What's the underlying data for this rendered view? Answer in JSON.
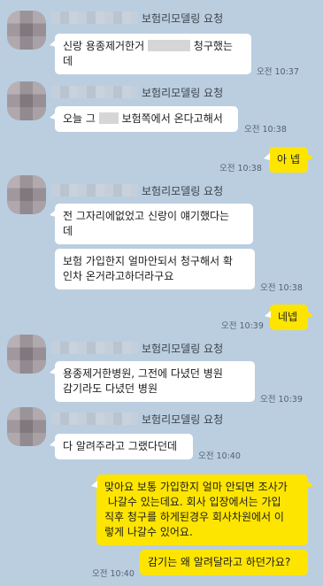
{
  "sender": {
    "display_name": "보험리모델링 요청"
  },
  "messages": [
    {
      "id": "m1",
      "pre": "신랑 용종제거한거 ",
      "post": " 청구했는\n데",
      "time": "오전 10:37"
    },
    {
      "id": "m2",
      "pre": "오늘 그 ",
      "post": " 보험쪽에서 온다고해서",
      "time": "오전 10:38"
    },
    {
      "id": "m3",
      "text": "아 넵",
      "time": "오전 10:38"
    },
    {
      "id": "m4",
      "text": "전 그자리에없었고 신랑이 얘기했다는\n데"
    },
    {
      "id": "m5",
      "text": "보험 가입한지 얼마안되서 청구해서 확\n인차 온거라고하더라구요",
      "time": "오전 10:38"
    },
    {
      "id": "m6",
      "text": "네넵",
      "time": "오전 10:39"
    },
    {
      "id": "m7",
      "text": "용종제거한병원, 그전에 다녔던 병원\n감기라도 다녔던 병원",
      "time": "오전 10:39"
    },
    {
      "id": "m8",
      "text": "다 알려주라고 그랬다던데",
      "time": "오전 10:40"
    },
    {
      "id": "m9",
      "text": "맞아요 보통 가입한지 얼마 안되면 조사가\n 나갈수 있는데요. 회사 입장에서는 가입\n직후 청구를 하게된경우 회사차원에서 이\n렇게 나갈수 있어요."
    },
    {
      "id": "m10",
      "text": "감기는 왜 알려달라고 하던가요?",
      "time": "오전 10:40"
    }
  ]
}
